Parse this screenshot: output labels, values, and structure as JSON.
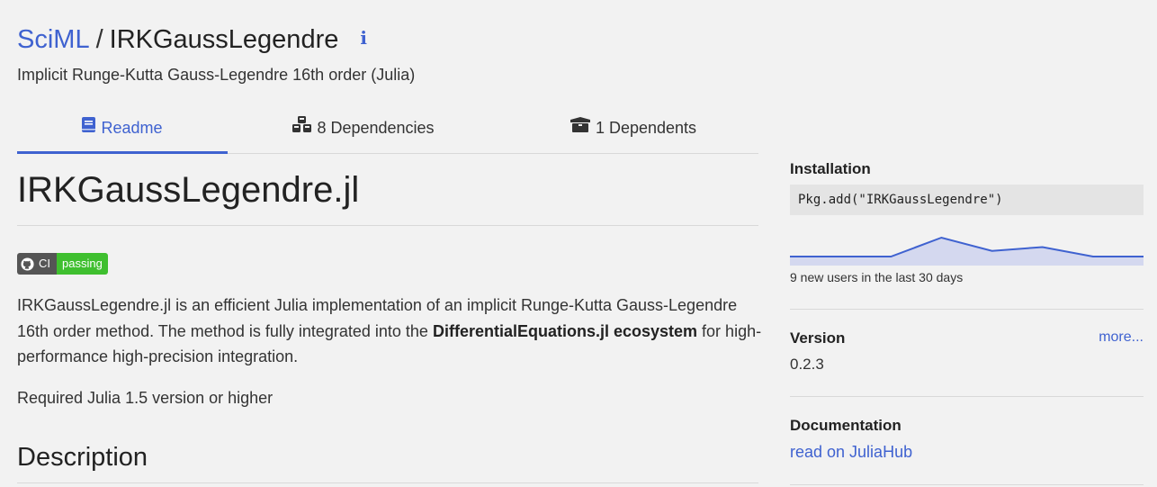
{
  "header": {
    "org": "SciML",
    "separator": "/",
    "package_name": "IRKGaussLegendre",
    "info_icon": "i",
    "subtitle": "Implicit Runge-Kutta Gauss-Legendre 16th order (Julia)"
  },
  "tabs": [
    {
      "label": "Readme",
      "icon": "book-icon",
      "active": true
    },
    {
      "label": "8 Dependencies",
      "icon": "cubes-icon",
      "active": false
    },
    {
      "label": "1 Dependents",
      "icon": "box-open-icon",
      "active": false
    }
  ],
  "readme": {
    "title": "IRKGaussLegendre.jl",
    "badge": {
      "left": "CI",
      "right": "passing"
    },
    "para_before": "IRKGaussLegendre.jl is an efficient Julia implementation of an implicit Runge-Kutta Gauss-Legendre 16th order method. The method is fully integrated into the ",
    "para_bold": "DifferentialEquations.jl ecosystem",
    "para_after": " for high-performance high-precision integration.",
    "requirement": "Required Julia 1.5 version or higher",
    "section_heading": "Description"
  },
  "sidebar": {
    "installation": {
      "title": "Installation",
      "command": "Pkg.add(\"IRKGaussLegendre\")",
      "users_text": "9 new users in the last 30 days",
      "sparkline": [
        0,
        0,
        0,
        1,
        0.3,
        0.5,
        0,
        0
      ]
    },
    "version": {
      "title": "Version",
      "more_link": "more...",
      "value": "0.2.3"
    },
    "documentation": {
      "title": "Documentation",
      "link": "read on JuliaHub"
    }
  },
  "colors": {
    "accent": "#3f62d0",
    "badge_pass": "#3fbf2f"
  }
}
